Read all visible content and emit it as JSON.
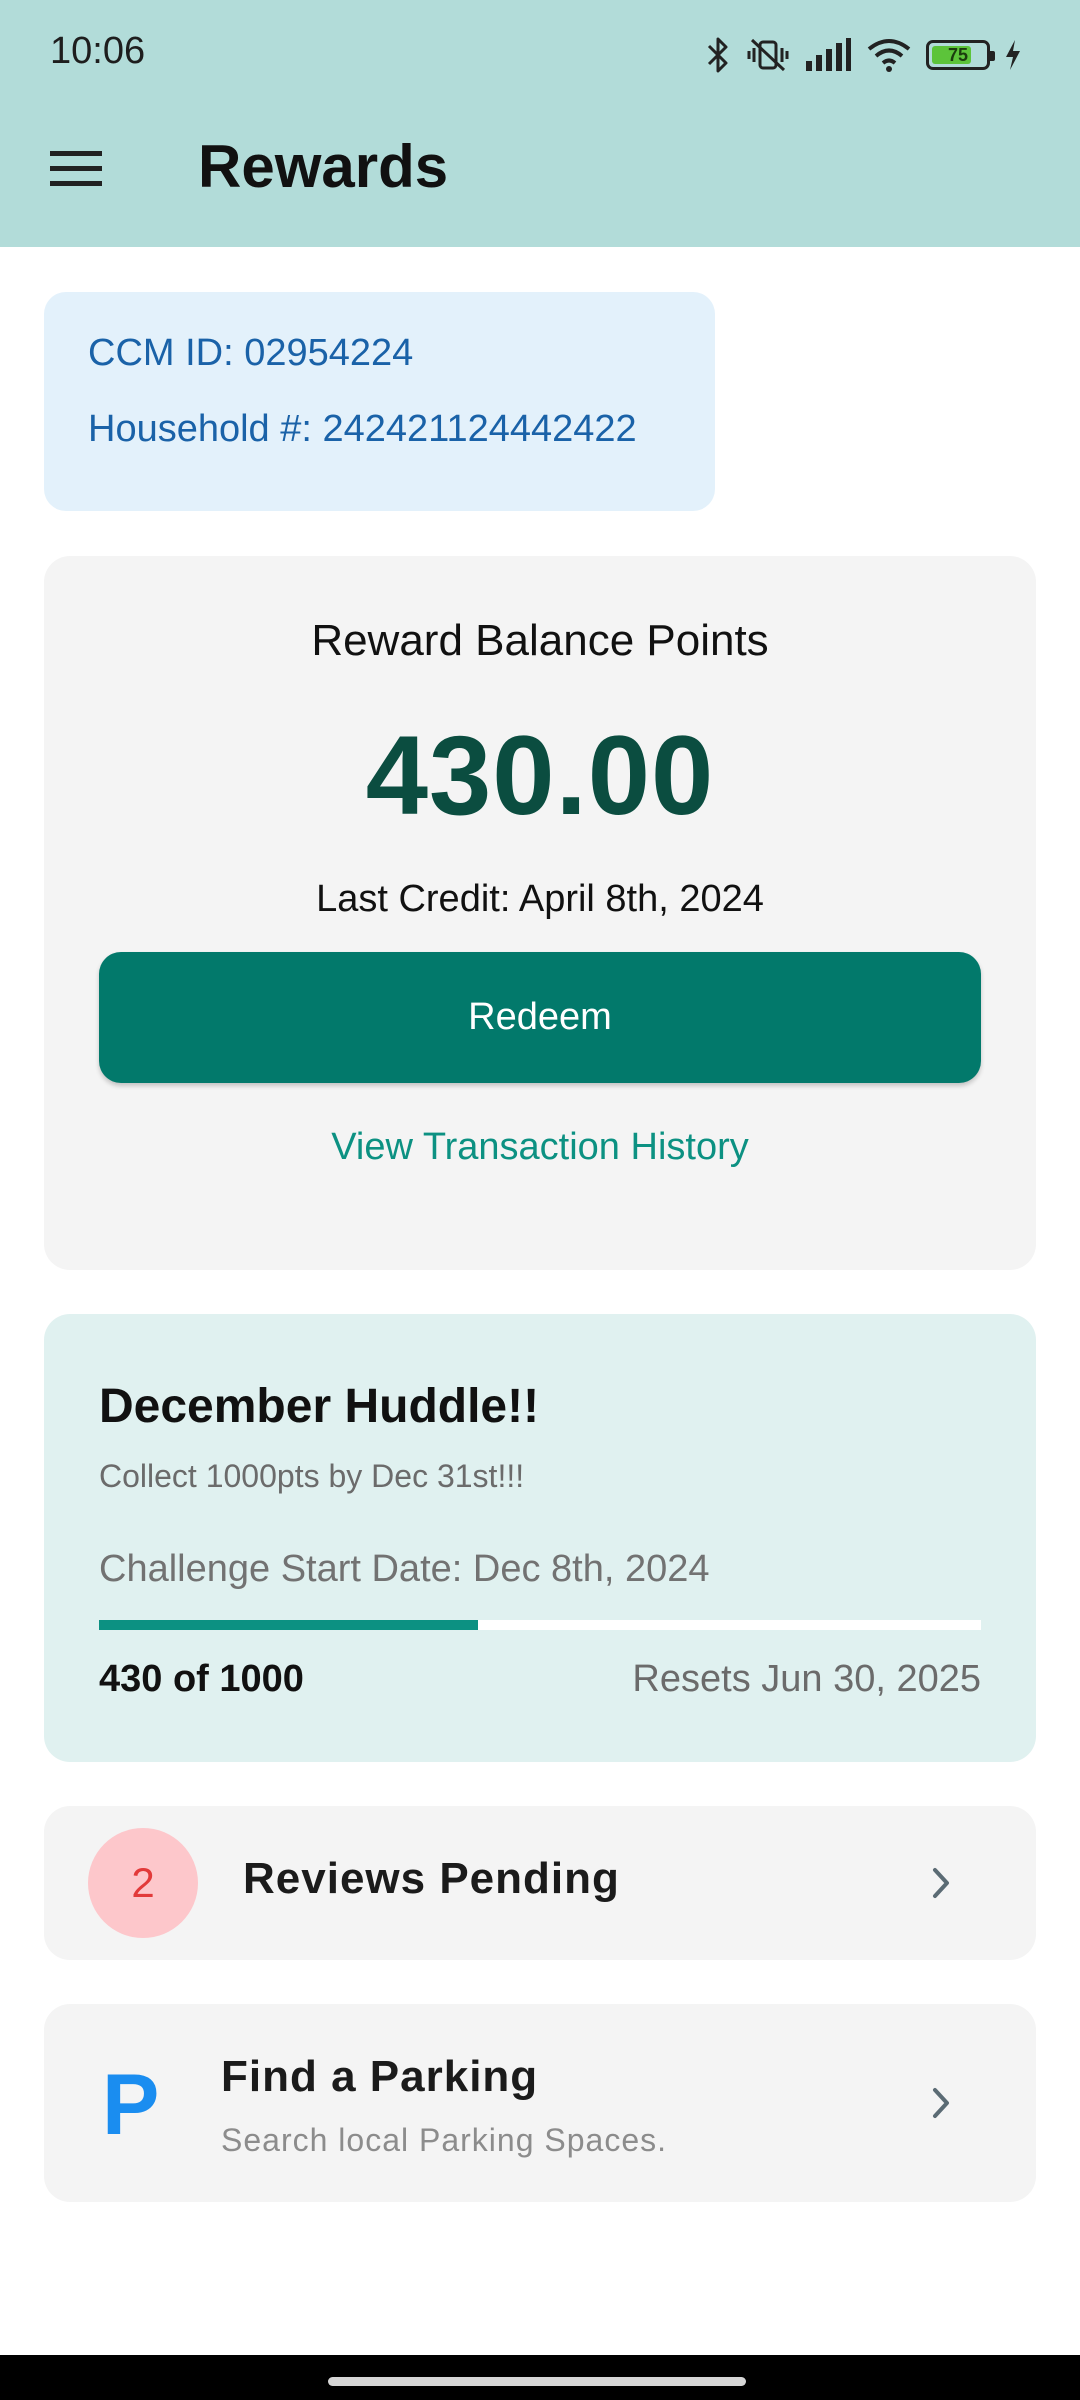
{
  "status_bar": {
    "time": "10:06",
    "battery_level": "75",
    "battery_fraction": 0.75,
    "icons": [
      "bluetooth-icon",
      "vibrate-off-icon",
      "signal-icon",
      "wifi-icon",
      "battery-icon",
      "charging-bolt-icon"
    ]
  },
  "app_bar": {
    "title": "Rewards",
    "menu_icon": "hamburger-menu-icon"
  },
  "account": {
    "ccm_id": "CCM ID: 02954224",
    "household": "Household #: 242421124442422"
  },
  "balance": {
    "heading": "Reward Balance Points",
    "value": "430.00",
    "last_credit": "Last Credit: April 8th, 2024",
    "redeem_label": "Redeem",
    "history_link": "View Transaction History"
  },
  "challenge": {
    "title": "December Huddle!!",
    "subtitle": "Collect 1000pts by Dec 31st!!!",
    "start_date": "Challenge Start Date: Dec 8th, 2024",
    "progress_label": "430 of 1000",
    "progress_fraction": 0.43,
    "resets": "Resets Jun 30, 2025"
  },
  "reviews": {
    "count": "2",
    "label": "Reviews Pending"
  },
  "parking": {
    "icon_letter": "P",
    "title": "Find a Parking",
    "subtitle": "Search local Parking Spaces."
  },
  "colors": {
    "app_bar": "#b2dcd9",
    "primary": "#02796b",
    "balance_text": "#0b4d40",
    "link": "#0c9182",
    "id_text": "#1a62a8",
    "badge_bg": "#fdc7cb",
    "badge_text": "#e23a3a",
    "parking_icon": "#1a8df0"
  }
}
